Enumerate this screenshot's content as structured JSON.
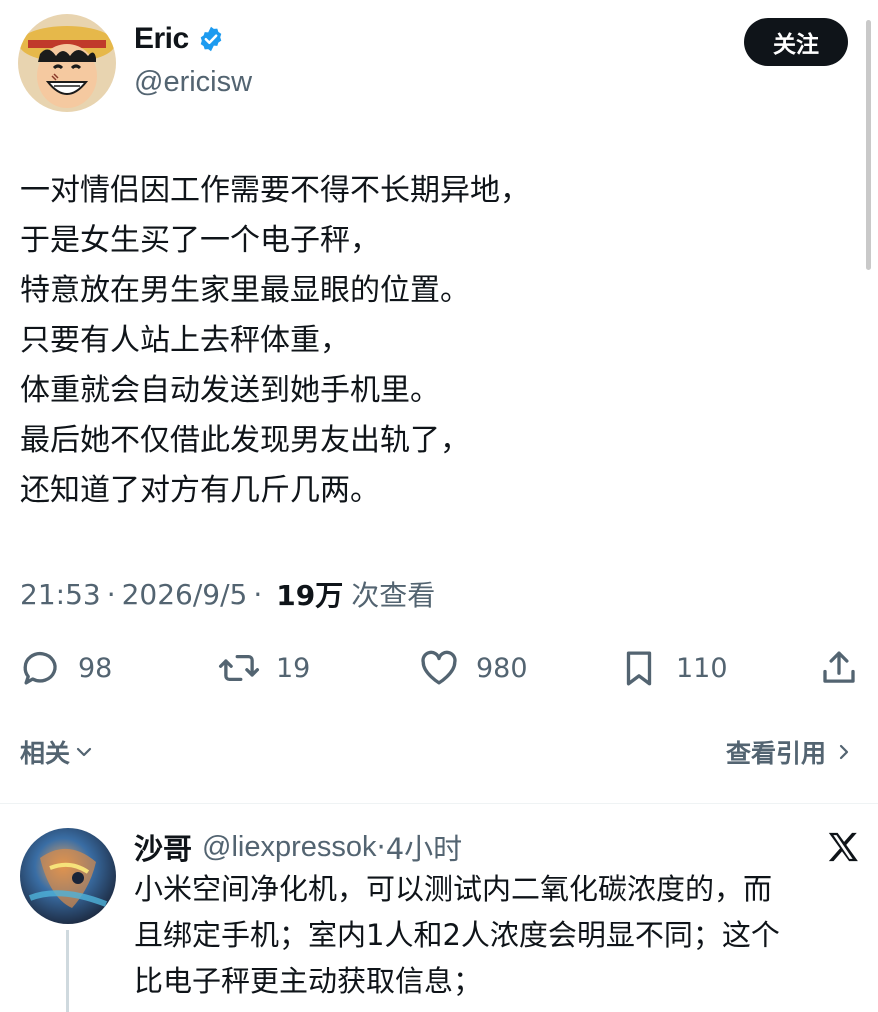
{
  "author": {
    "display_name": "Eric",
    "handle": "@ericisw",
    "verified": true,
    "avatar": "cartoon-straw-hat-boy-avatar"
  },
  "follow_label": "关注",
  "tweet": {
    "lines": [
      "一对情侣因工作需要不得不长期异地，",
      "于是女生买了一个电子秤，",
      "特意放在男生家里最显眼的位置。",
      "只要有人站上去秤体重，",
      "体重就会自动发送到她手机里。",
      "最后她不仅借此发现男友出轨了，",
      "还知道了对方有几斤几两。"
    ],
    "time": "21:53",
    "date": "2026/9/5",
    "views_count": "19万",
    "views_label": "次查看"
  },
  "actions": {
    "replies": "98",
    "retweets": "19",
    "likes": "980",
    "bookmarks": "110"
  },
  "related_label": "相关",
  "quotes_label": "查看引用",
  "reply": {
    "name": "沙哥",
    "handle": "@liexpressok",
    "time": "4小时",
    "lines": [
      "小米空间净化机，可以测试内二氧化碳浓度的，而",
      "且绑定手机；室内1人和2人浓度会明显不同；这个",
      "比电子秤更主动获取信息；"
    ]
  },
  "colors": {
    "text": "#0f1419",
    "secondary": "#536471",
    "verified": "#1d9bf0",
    "follow_bg": "#0f1419"
  }
}
